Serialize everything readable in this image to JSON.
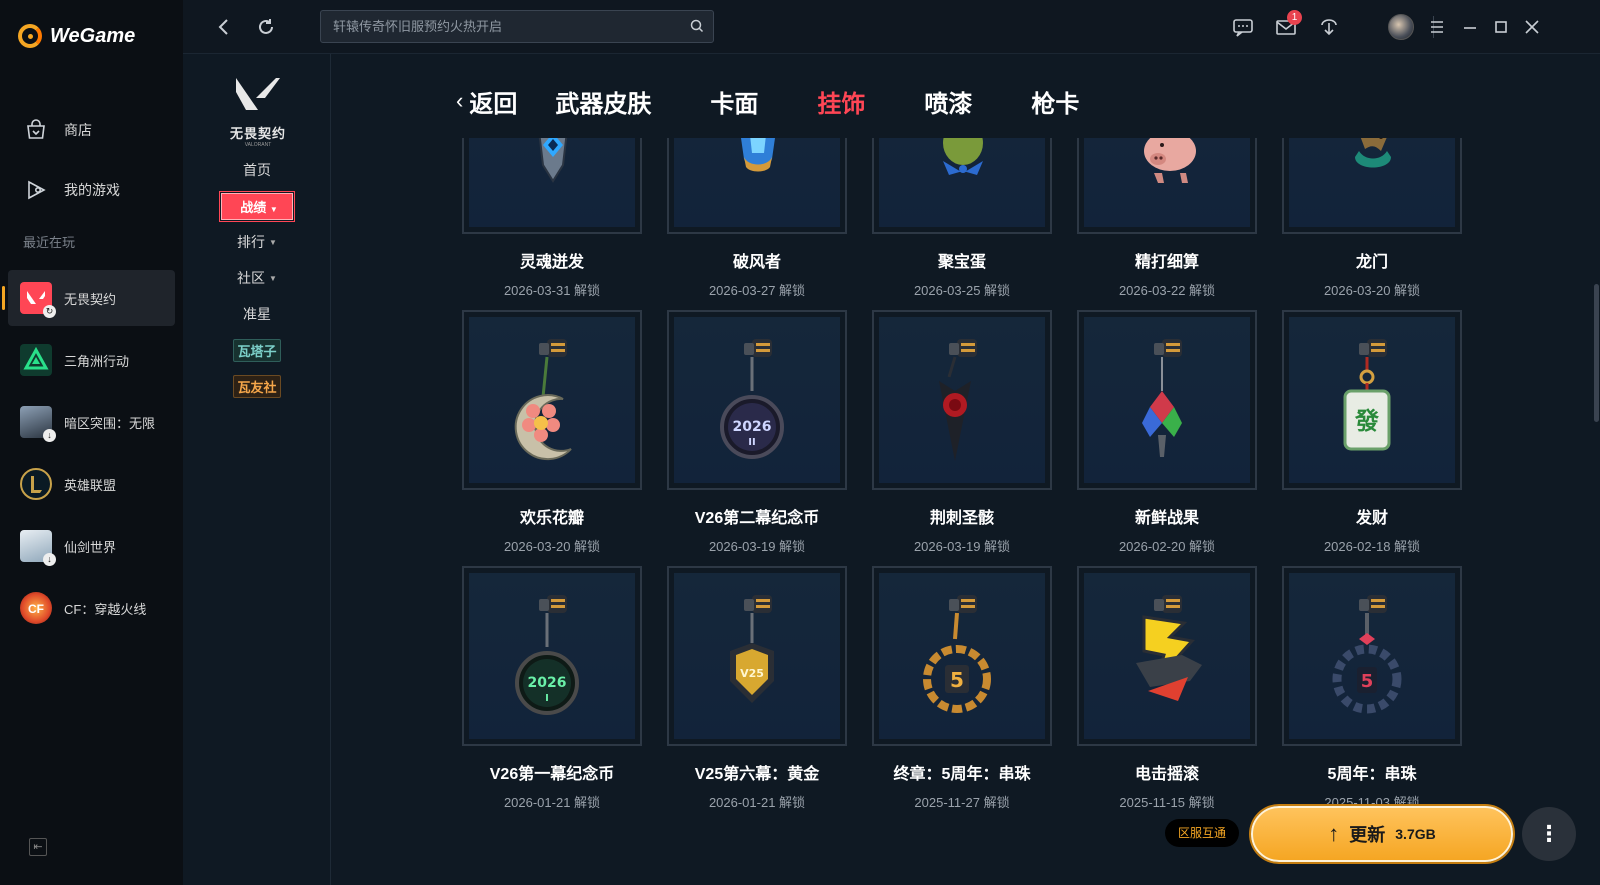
{
  "app": {
    "brand": "WeGame"
  },
  "rail": {
    "nav": [
      {
        "label": "商店",
        "icon": "store-bag-icon"
      },
      {
        "label": "我的游戏",
        "icon": "my-games-icon"
      }
    ],
    "recent_label": "最近在玩",
    "games": [
      {
        "label": "无畏契约",
        "active": true,
        "color": "#ff4655"
      },
      {
        "label": "三角洲行动",
        "color": "#1fae6b"
      },
      {
        "label": "暗区突围：无限",
        "color": "#3b4a5c"
      },
      {
        "label": "英雄联盟",
        "color": "#c8a24a"
      },
      {
        "label": "仙剑世界",
        "color": "#7b9bb3"
      },
      {
        "label": "CF：穿越火线",
        "color": "#e04a2a"
      }
    ]
  },
  "topbar": {
    "search_placeholder": "轩辕传奇怀旧服预约火热开启",
    "mail_count": "1"
  },
  "subnav": {
    "logo_title": "无畏契约",
    "logo_sub": "VALORANT",
    "items": {
      "home": "首页",
      "zhanji": "战绩",
      "rank": "排行",
      "community": "社区",
      "crosshair": "准星",
      "wataizi": "瓦塔子",
      "wayoushe": "瓦友社"
    }
  },
  "tabs": {
    "back": "返回",
    "skins": "武器皮肤",
    "cards": "卡面",
    "charms": "挂饰",
    "sprays": "喷漆",
    "gun_cards": "枪卡"
  },
  "items": [
    {
      "name": "灵魂迸发",
      "date": "2026-03-31 解锁"
    },
    {
      "name": "破风者",
      "date": "2026-03-27 解锁"
    },
    {
      "name": "聚宝蛋",
      "date": "2026-03-25 解锁"
    },
    {
      "name": "精打细算",
      "date": "2026-03-22 解锁"
    },
    {
      "name": "龙门",
      "date": "2026-03-20 解锁"
    },
    {
      "name": "欢乐花瓣",
      "date": "2026-03-20 解锁"
    },
    {
      "name": "V26第二幕纪念币",
      "date": "2026-03-19 解锁"
    },
    {
      "name": "荆刺圣骸",
      "date": "2026-03-19 解锁"
    },
    {
      "name": "新鲜战果",
      "date": "2026-02-20 解锁"
    },
    {
      "name": "发财",
      "date": "2026-02-18 解锁"
    },
    {
      "name": "V26第一幕纪念币",
      "date": "2026-01-21 解锁"
    },
    {
      "name": "V25第六幕：黄金",
      "date": "2026-01-21 解锁"
    },
    {
      "name": "终章：5周年：串珠",
      "date": "2025-11-27 解锁"
    },
    {
      "name": "电击摇滚",
      "date": "2025-11-15 解锁"
    },
    {
      "name": "5周年：串珠",
      "date": "2025-11-03 解锁"
    }
  ],
  "charm_art": {
    "coin_2026_2": "2026",
    "coin_2026_2_sub": "II",
    "coin_2026_1": "2026",
    "coin_2026_1_sub": "I",
    "gold_v25": "V25",
    "num_5": "5",
    "mahjong": "發"
  },
  "footer": {
    "region": "区服互通",
    "update_label": "更新",
    "update_size": "3.7GB",
    "more": "⋮"
  },
  "colors": {
    "accent": "#ff4655",
    "brand": "#f5a623",
    "bg": "#0f1923"
  }
}
